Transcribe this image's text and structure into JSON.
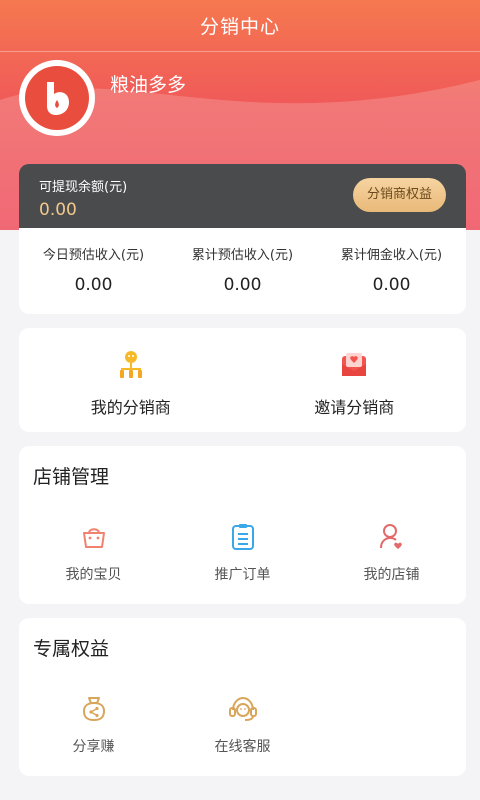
{
  "header": {
    "title": "分销中心"
  },
  "user": {
    "name": "粮油多多"
  },
  "balance": {
    "label": "可提现余额(元)",
    "value": "0.00",
    "rights_button": "分销商权益"
  },
  "stats": [
    {
      "label": "今日预估收入(元)",
      "value": "0.00"
    },
    {
      "label": "累计预估收入(元)",
      "value": "0.00"
    },
    {
      "label": "累计佣金收入(元)",
      "value": "0.00"
    }
  ],
  "distributor": {
    "items": [
      {
        "label": "我的分销商",
        "icon": "org-chart-icon"
      },
      {
        "label": "邀请分销商",
        "icon": "envelope-heart-icon"
      }
    ]
  },
  "store": {
    "title": "店铺管理",
    "items": [
      {
        "label": "我的宝贝",
        "icon": "bag-icon"
      },
      {
        "label": "推广订单",
        "icon": "order-list-icon"
      },
      {
        "label": "我的店铺",
        "icon": "user-heart-icon"
      }
    ]
  },
  "rights": {
    "title": "专属权益",
    "items": [
      {
        "label": "分享赚",
        "icon": "share-bag-icon"
      },
      {
        "label": "在线客服",
        "icon": "headset-icon"
      }
    ]
  },
  "colors": {
    "hero_top": "#f5784f",
    "hero_bottom": "#ee4757",
    "balance_card": "#4a4b4d",
    "gold": "#f2c98d",
    "page_bg": "#f4f4f6"
  }
}
